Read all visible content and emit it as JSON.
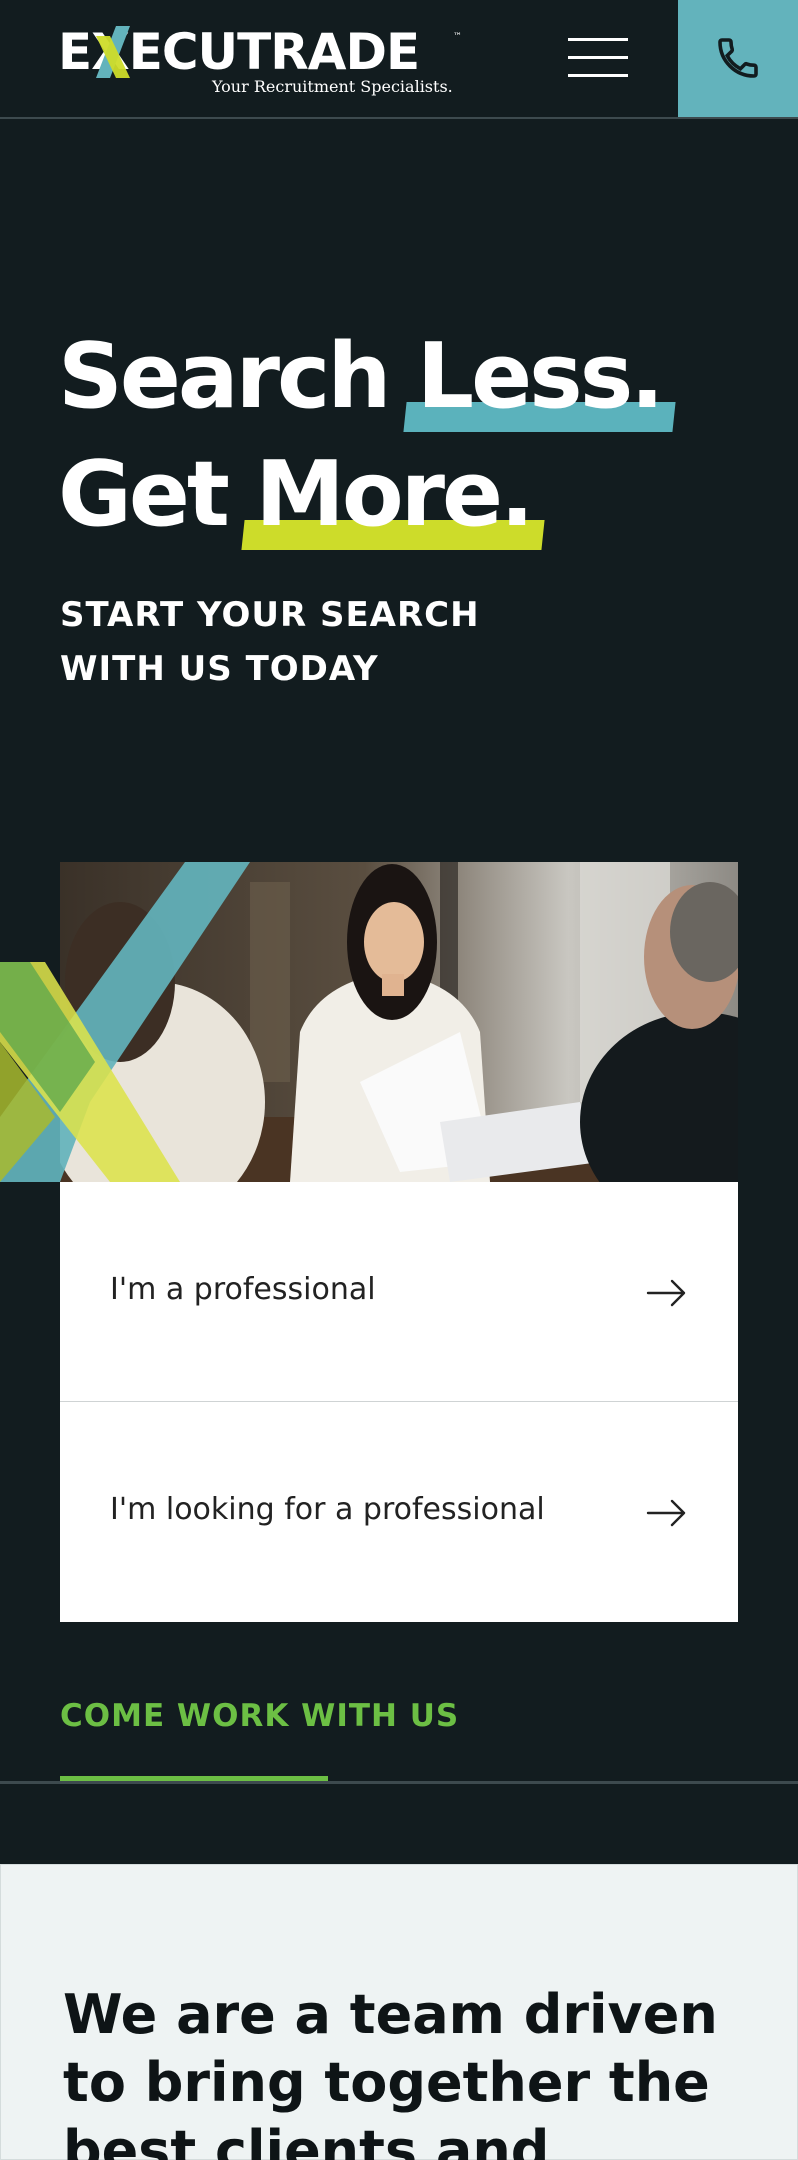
{
  "header": {
    "logo_word": "EXECUTRADE",
    "logo_trademark": "™",
    "logo_tagline": "Your Recruitment Specialists.",
    "accent_phone_bg": "#63b3bc"
  },
  "hero": {
    "line1_plain": "Search ",
    "line1_highlight": "Less.",
    "line2_plain": "Get ",
    "line2_highlight": "More.",
    "subhead": "START YOUR SEARCH WITH US TODAY",
    "highlight_colors": {
      "teal": "#5bb2bc",
      "lime": "#cddc2a"
    }
  },
  "options": [
    {
      "label": "I'm a professional",
      "icon": "arrow-right-icon"
    },
    {
      "label": "I'm looking for a professional",
      "icon": "arrow-right-icon"
    }
  ],
  "cta": {
    "label": "COME WORK WITH US",
    "color": "#6cbf44"
  },
  "about": {
    "heading": "We are a team driven to bring together the best clients and"
  },
  "icons": {
    "menu": "hamburger-menu-icon",
    "phone": "phone-icon"
  }
}
